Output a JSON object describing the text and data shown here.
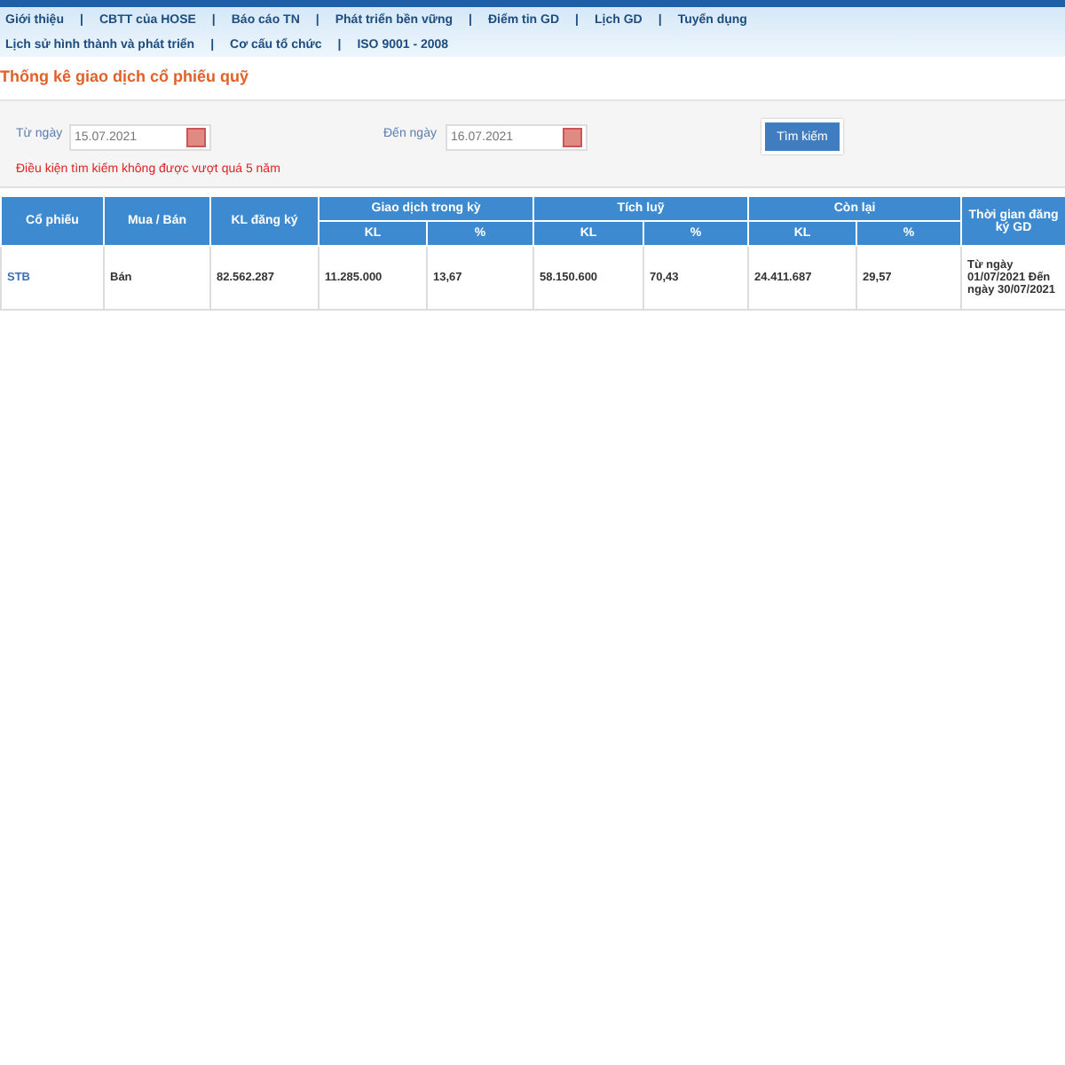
{
  "nav_row_1": [
    "Giới thiệu",
    "CBTT của HOSE",
    "Báo cáo TN",
    "Phát triển bền vững",
    "Điểm tin GD",
    "Lịch GD",
    "Tuyển dụng"
  ],
  "nav_row_2": [
    "Lịch sử hình thành và phát triển",
    "Cơ cấu tổ chức",
    "ISO 9001 - 2008"
  ],
  "nav_separator": "|",
  "page_title": "Thống kê giao dịch cổ phiếu quỹ",
  "search": {
    "from_label": "Từ ngày",
    "from_value": "15.07.2021",
    "to_label": "Đến ngày",
    "to_value": "16.07.2021",
    "button": "Tìm kiếm",
    "warning": "Điều kiện tìm kiếm không được vượt quá 5 năm"
  },
  "table": {
    "header_top": [
      {
        "label": "Cổ phiếu",
        "kind": "single"
      },
      {
        "label": "Mua / Bán",
        "kind": "single"
      },
      {
        "label": "KL đăng ký",
        "kind": "single"
      },
      {
        "label": "Giao dịch trong kỳ",
        "kind": "group"
      },
      {
        "label": "Tích luỹ",
        "kind": "group"
      },
      {
        "label": "Còn lại",
        "kind": "group"
      },
      {
        "label": "Thời gian đăng ký GD",
        "kind": "single"
      }
    ],
    "header_sub": [
      "KL",
      "%",
      "KL",
      "%",
      "KL",
      "%"
    ],
    "rows": [
      {
        "cells": [
          "STB",
          "Bán",
          "82.562.287",
          "11.285.000",
          "13,67",
          "58.150.600",
          "70,43",
          "24.411.687",
          "29,57",
          "Từ ngày 01/07/2021 Đến ngày 30/07/2021"
        ]
      }
    ]
  }
}
